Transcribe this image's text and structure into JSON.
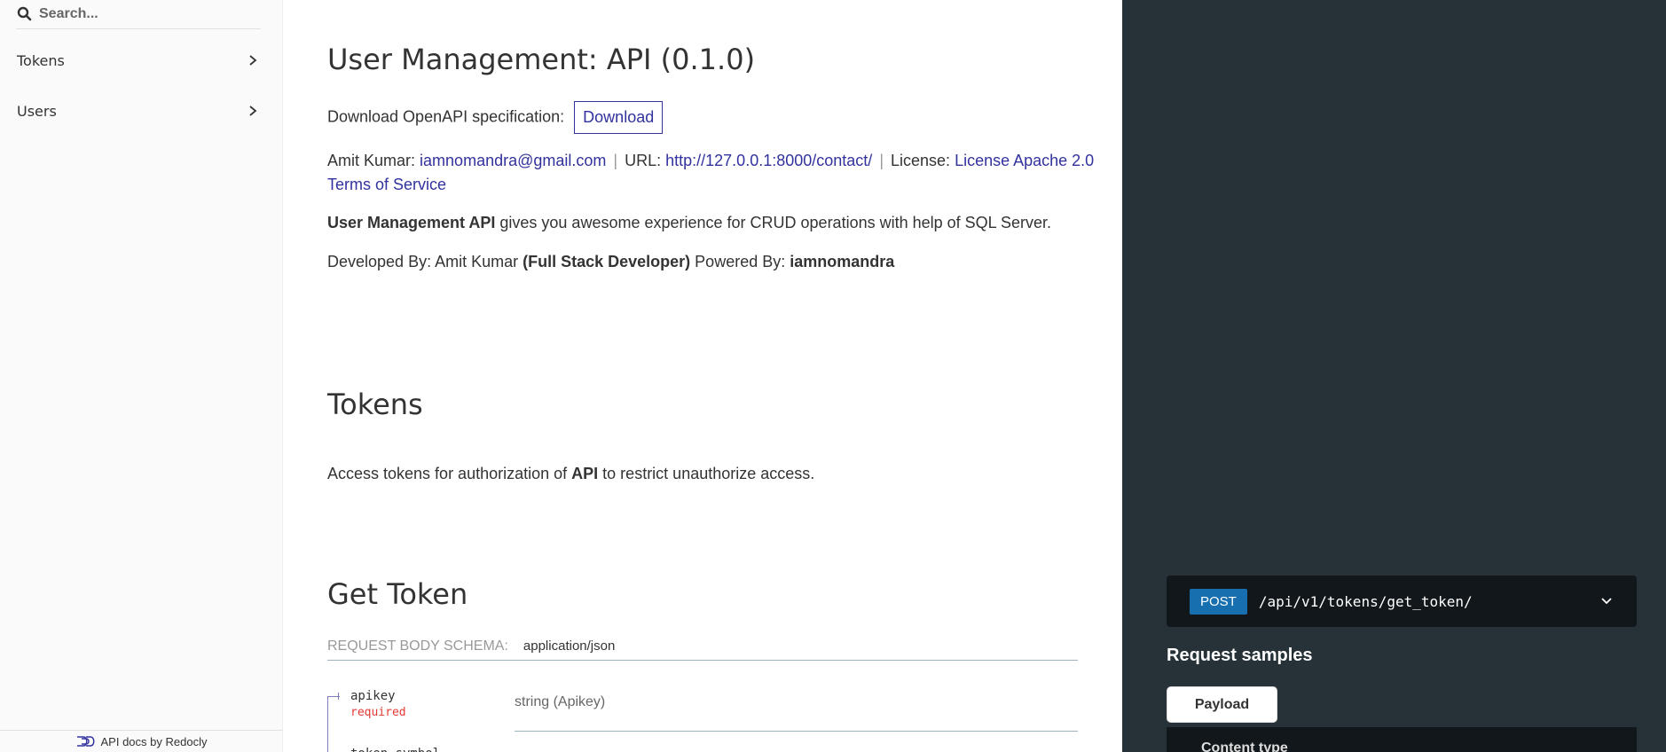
{
  "sidebar": {
    "search_placeholder": "Search...",
    "items": [
      {
        "label": "Tokens"
      },
      {
        "label": "Users"
      }
    ],
    "footer": "API docs by Redocly"
  },
  "main": {
    "title": "User Management: API (0.1.0)",
    "download_prefix": "Download OpenAPI specification:",
    "download_label": "Download",
    "contact_name_prefix": "Amit Kumar:",
    "contact_email": "iamnomandra@gmail.com",
    "url_prefix": "URL:",
    "url": "http://127.0.0.1:8000/contact/",
    "license_prefix": "License:",
    "license": "License Apache 2.0",
    "terms": "Terms of Service",
    "desc_bold": "User Management API",
    "desc_rest": " gives you awesome experience for CRUD operations with help of SQL Server.",
    "dev_prefix": "Developed By: Amit Kumar ",
    "dev_bold": "(Full Stack Developer)",
    "powered_prefix": " Powered By: ",
    "powered_bold": "iamnomandra",
    "tokens_heading": "Tokens",
    "tokens_desc_a": "Access tokens for authorization of ",
    "tokens_desc_bold": "API",
    "tokens_desc_b": " to restrict unauthorize access.",
    "get_token_heading": "Get Token",
    "request_body_label": "REQUEST BODY SCHEMA:",
    "request_body_type": "application/json",
    "properties": [
      {
        "name": "apikey",
        "required": "required",
        "type": "string (Apikey)"
      }
    ],
    "next_property": "token_symbol"
  },
  "right": {
    "method": "POST",
    "path": "/api/v1/tokens/get_token/",
    "request_samples": "Request samples",
    "payload_tab": "Payload",
    "content_type": "Content type"
  },
  "colors": {
    "link": "#32329f",
    "required": "#e53935",
    "right_bg": "#263238",
    "method_bg": "#186fAF"
  }
}
